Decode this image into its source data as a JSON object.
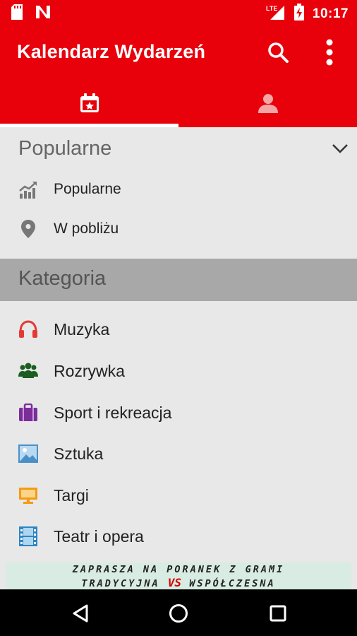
{
  "status_bar": {
    "time": "10:17",
    "network": "LTE",
    "icons": [
      "sd-card-icon",
      "notification-n-icon",
      "signal-icon",
      "battery-charging-icon"
    ]
  },
  "app_bar": {
    "title": "Kalendarz Wydarzeń",
    "actions": [
      "search-icon",
      "more-vert-icon"
    ]
  },
  "tabs": [
    {
      "icon": "calendar-icon",
      "selected": true
    },
    {
      "icon": "person-icon",
      "selected": false
    }
  ],
  "popular_section": {
    "title": "Popularne",
    "expanded": true,
    "items": [
      {
        "label": "Popularne",
        "icon": "trending-chart-icon"
      },
      {
        "label": "W pobliżu",
        "icon": "location-pin-icon"
      }
    ]
  },
  "category_section": {
    "title": "Kategoria",
    "items": [
      {
        "label": "Muzyka",
        "icon": "headphones-icon"
      },
      {
        "label": "Rozrywka",
        "icon": "people-group-icon"
      },
      {
        "label": "Sport i rekreacja",
        "icon": "briefcase-icon"
      },
      {
        "label": "Sztuka",
        "icon": "picture-icon"
      },
      {
        "label": "Targi",
        "icon": "monitor-icon"
      },
      {
        "label": "Teatr i opera",
        "icon": "film-strip-icon"
      }
    ]
  },
  "ad_banner": {
    "line1": "ZAPRASZA NA PORANEK Z GRAMI",
    "line2_left": "TRADYCYJNA",
    "line2_vs": "VS",
    "line2_right": "WSPÓŁCZESNA"
  },
  "nav_bar": {
    "buttons": [
      "back-icon",
      "home-icon",
      "recents-icon"
    ]
  },
  "colors": {
    "primary": "#e8000b",
    "background": "#e8e8e8",
    "category_header": "#a8a8a8",
    "music": "#e53935",
    "entertainment": "#1b5e20",
    "sport": "#7b2d9a",
    "art": "#4a90c8",
    "fairs": "#f39c12",
    "theatre": "#2e86c1"
  }
}
